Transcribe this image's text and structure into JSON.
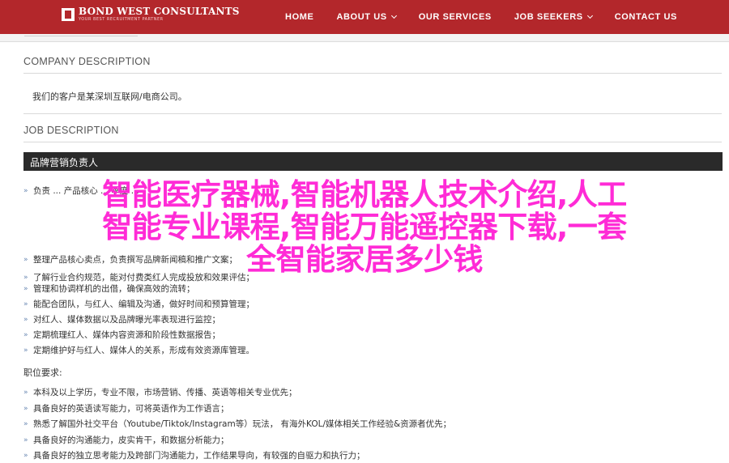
{
  "header": {
    "logo_name": "BOND WEST CONSULTANTS",
    "logo_tagline": "YOUR BEST RECRUITMENT PARTNER",
    "nav": [
      {
        "label": "HOME",
        "dropdown": false
      },
      {
        "label": "ABOUT US",
        "dropdown": true
      },
      {
        "label": "OUR SERVICES",
        "dropdown": false
      },
      {
        "label": "JOB SEEKERS",
        "dropdown": true
      },
      {
        "label": "CONTACT US",
        "dropdown": false
      }
    ],
    "colors": {
      "bar": "#b3272b",
      "accent": "#ff2bd6"
    }
  },
  "company": {
    "heading": "COMPANY DESCRIPTION",
    "text": "我们的客户是某深圳互联网/电商公司。"
  },
  "job": {
    "heading": "JOB DESCRIPTION",
    "title": "品牌营销负责人",
    "duties_partial": [
      "负责 ... 产品核心 ... 季度 ...",
      "",
      "",
      "",
      "整理产品核心卖点，负责撰写品牌新闻稿和推广文案；",
      "了解行业合约规范，能对付费类红人完成投放和效果评估；",
      "管理和协调样机的出借，确保高效的流转；",
      "能配合团队，与红人、编辑及沟通，做好时间和预算管理；",
      "对红人、媒体数据以及品牌曝光率表现进行监控；",
      "定期梳理红人、媒体内容资源和阶段性数据报告；",
      "定期维护好与红人、媒体人的关系，形成有效资源库管理。"
    ],
    "requirements_heading": "职位要求:",
    "requirements": [
      "本科及以上学历，专业不限，市场营销、传播、英语等相关专业优先；",
      "具备良好的英语读写能力，可将英语作为工作语言；",
      "熟悉了解国外社交平台（Youtube/Tiktok/Instagram等）玩法， 有海外KOL/媒体相关工作经验&资源者优先；",
      "具备良好的沟通能力，皮实肯干，和数据分析能力；",
      "具备良好的独立思考能力及跨部门沟通能力，工作结果导向，有较强的自驱力和执行力；"
    ]
  },
  "overlay": {
    "lines": [
      "智能医疗器械,智能机器人技术介绍,人工",
      "智能专业课程,智能万能遥控器下载,一套",
      "全智能家居多少钱"
    ]
  }
}
